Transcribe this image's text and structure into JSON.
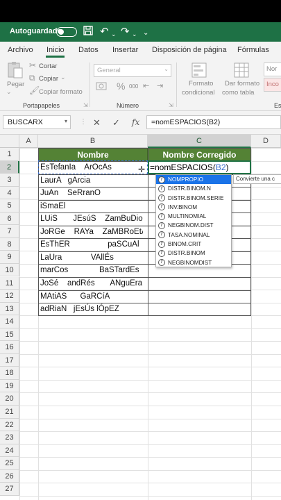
{
  "titlebar": {
    "autosave_label": "Autoguardado",
    "icons": [
      "save-icon",
      "undo-icon",
      "redo-icon",
      "customize-icon"
    ]
  },
  "tabs": [
    "Archivo",
    "Inicio",
    "Datos",
    "Insertar",
    "Disposición de página",
    "Fórmulas"
  ],
  "active_tab": "Inicio",
  "ribbon": {
    "paste_label": "Pegar",
    "cut_label": "Cortar",
    "copy_label": "Copiar",
    "copy_format_label": "Copiar formato",
    "clipboard_group": "Portapapeles",
    "number_format_value": "General",
    "number_group": "Número",
    "percent_symbol": "%",
    "thousands_label": "000",
    "cond_format_label1": "Formato",
    "cond_format_label2": "condicional",
    "table_format_label1": "Dar formato",
    "table_format_label2": "como tabla",
    "style_normal": "Nor",
    "style_bad": "Inco",
    "group_cut": "Es"
  },
  "formula_bar": {
    "name_box": "BUSCARX",
    "cancel_symbol": "✕",
    "enter_symbol": "✓",
    "fx_symbol": "fx",
    "formula": "=nomESPACIOS(B2)"
  },
  "columns": [
    "A",
    "B",
    "C",
    "D"
  ],
  "rows": [
    "1",
    "2",
    "3",
    "4",
    "5",
    "6",
    "7",
    "8",
    "9",
    "10",
    "11",
    "12",
    "13",
    "14",
    "15",
    "16",
    "17",
    "18",
    "19",
    "20",
    "21",
    "22",
    "23",
    "24",
    "25",
    "26",
    "27"
  ],
  "table": {
    "header_b": "Nombre",
    "header_c": "Nombre Corregido",
    "names": [
      "EsTefanIa    ArOcAs",
      "LaurA   gArcia",
      "JuAn    SeRranO",
      "iSmaEl",
      "LUiS       JEsúS    ZamBuDio",
      "JoRGe    RAYa    ZaMBRoEtA",
      "EsThER                 paSCuAl",
      "LaUra             VAllÉs",
      "marCos              BaSTardEs",
      "JoSé    andRés       ANguEra",
      "MAtiAS      GaRCíA",
      "adRiaN   jEsÚs lÓpEZ"
    ],
    "c2_prefix": "=nomESPACIOS(",
    "c2_ref": "B2",
    "c2_suffix": ")"
  },
  "autocomplete": {
    "items": [
      "NOMPROPIO",
      "DISTR.BINOM.N",
      "DISTR.BINOM.SERIE",
      "INV.BINOM",
      "MULTINOMIAL",
      "NEGBINOM.DIST",
      "TASA.NOMINAL",
      "BINOM.CRIT",
      "DISTR.BINOM",
      "NEGBINOMDIST"
    ],
    "selected_index": 0,
    "tooltip": "Convierte una c"
  },
  "colors": {
    "excel_green": "#1e7145",
    "header_fill": "#548235",
    "selection": "#217346",
    "ref_blue": "#3b6cc9"
  }
}
